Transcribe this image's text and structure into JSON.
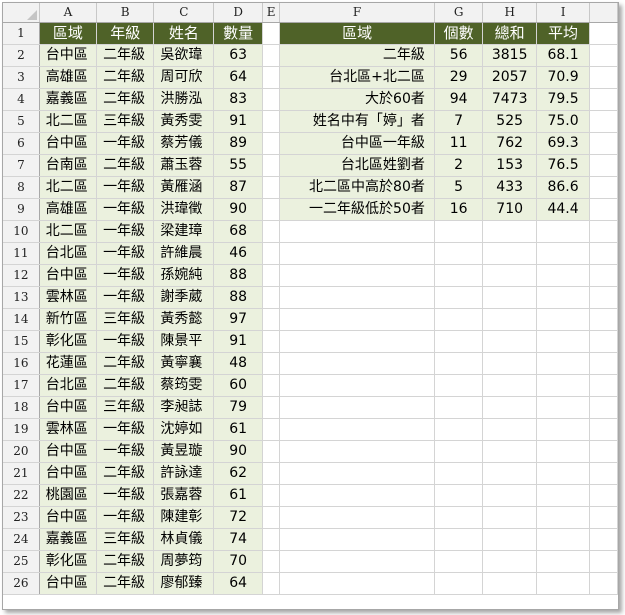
{
  "columns": [
    "A",
    "B",
    "C",
    "D",
    "E",
    "F",
    "G",
    "H",
    "I"
  ],
  "row_numbers": [
    "1",
    "2",
    "3",
    "4",
    "5",
    "6",
    "7",
    "8",
    "9",
    "10",
    "11",
    "12",
    "13",
    "14",
    "15",
    "16",
    "17",
    "18",
    "19",
    "20",
    "21",
    "22",
    "23",
    "24",
    "25",
    "26"
  ],
  "left_header": [
    "區域",
    "年級",
    "姓名",
    "數量"
  ],
  "left_rows": [
    [
      "台中區",
      "二年級",
      "吳欲瑋",
      "63"
    ],
    [
      "高雄區",
      "二年級",
      "周可欣",
      "64"
    ],
    [
      "嘉義區",
      "二年級",
      "洪勝泓",
      "83"
    ],
    [
      "北二區",
      "三年級",
      "黃秀雯",
      "91"
    ],
    [
      "台中區",
      "一年級",
      "蔡芳儀",
      "89"
    ],
    [
      "台南區",
      "二年級",
      "蕭玉蓉",
      "55"
    ],
    [
      "北二區",
      "一年級",
      "黃雁涵",
      "87"
    ],
    [
      "高雄區",
      "一年級",
      "洪瑋徵",
      "90"
    ],
    [
      "北二區",
      "一年級",
      "梁建璋",
      "68"
    ],
    [
      "台北區",
      "一年級",
      "許維晨",
      "46"
    ],
    [
      "台中區",
      "一年級",
      "孫婉純",
      "88"
    ],
    [
      "雲林區",
      "一年級",
      "謝季葳",
      "88"
    ],
    [
      "新竹區",
      "三年級",
      "黃秀懿",
      "97"
    ],
    [
      "彰化區",
      "一年級",
      "陳景平",
      "91"
    ],
    [
      "花蓮區",
      "二年級",
      "黃寧襄",
      "48"
    ],
    [
      "台北區",
      "二年級",
      "蔡筠雯",
      "60"
    ],
    [
      "台中區",
      "三年級",
      "李昶誌",
      "79"
    ],
    [
      "雲林區",
      "一年級",
      "沈婷如",
      "61"
    ],
    [
      "台中區",
      "一年級",
      "黃昱璇",
      "90"
    ],
    [
      "台中區",
      "二年級",
      "許詠達",
      "62"
    ],
    [
      "桃園區",
      "一年級",
      "張嘉蓉",
      "61"
    ],
    [
      "台中區",
      "一年級",
      "陳建彰",
      "72"
    ],
    [
      "嘉義區",
      "三年級",
      "林貞儀",
      "74"
    ],
    [
      "彰化區",
      "二年級",
      "周夢筠",
      "70"
    ],
    [
      "台中區",
      "二年級",
      "廖郁臻",
      "64"
    ]
  ],
  "right_header": [
    "區域",
    "個數",
    "總和",
    "平均"
  ],
  "right_rows": [
    [
      "二年級",
      "56",
      "3815",
      "68.1"
    ],
    [
      "台北區+北二區",
      "29",
      "2057",
      "70.9"
    ],
    [
      "大於60者",
      "94",
      "7473",
      "79.5"
    ],
    [
      "姓名中有「婷」者",
      "7",
      "525",
      "75.0"
    ],
    [
      "台中區一年級",
      "11",
      "762",
      "69.3"
    ],
    [
      "台北區姓劉者",
      "2",
      "153",
      "76.5"
    ],
    [
      "北二區中高於80者",
      "5",
      "433",
      "86.6"
    ],
    [
      "一二年級低於50者",
      "16",
      "710",
      "44.4"
    ]
  ]
}
